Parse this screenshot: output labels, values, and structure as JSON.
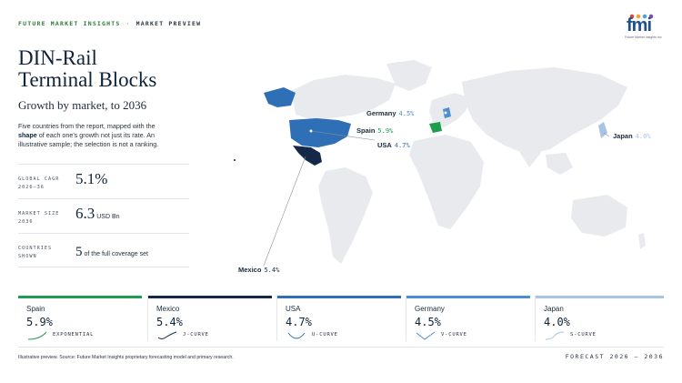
{
  "header": {
    "brand": "FUTURE MARKET INSIGHTS",
    "separator": "·",
    "section": "MARKET PREVIEW",
    "logo_text": "fmi",
    "logo_sub": "Future Market Insights Inc."
  },
  "title": {
    "line1": "DIN-Rail",
    "line2": "Terminal Blocks",
    "subtitle": "Growth by market, to 2036"
  },
  "description": {
    "part1": "Five countries from the report, mapped with the ",
    "bold": "shape",
    "part2": " of each one's growth not just its rate. An illustrative sample; the selection is not a ranking."
  },
  "stats": [
    {
      "label1": "GLOBAL CAGR",
      "label2": "2026–36",
      "value": "5.1%",
      "unit": ""
    },
    {
      "label1": "MARKET SIZE",
      "label2": "2036",
      "value": "6.3",
      "unit": "USD Bn"
    },
    {
      "label1": "COUNTRIES",
      "label2": "SHOWN",
      "value": "5",
      "unit": "of the full coverage set"
    }
  ],
  "map_callouts": [
    {
      "country": "Germany",
      "pct": "4.5%"
    },
    {
      "country": "Spain",
      "pct": "5.9%"
    },
    {
      "country": "USA",
      "pct": "4.7%"
    },
    {
      "country": "Japan",
      "pct": "4.0%"
    },
    {
      "country": "Mexico",
      "pct": "5.4%"
    }
  ],
  "colors": {
    "spain": "#1f9d4f",
    "mexico": "#14294a",
    "usa": "#2f6fb5",
    "germany": "#4a8fd0",
    "japan": "#a9c4e3",
    "land": "#e8eaed"
  },
  "cards": [
    {
      "name": "Spain",
      "value": "5.9%",
      "shape": "EXPONENTIAL",
      "color": "#1f9d4f"
    },
    {
      "name": "Mexico",
      "value": "5.4%",
      "shape": "J-CURVE",
      "color": "#14294a"
    },
    {
      "name": "USA",
      "value": "4.7%",
      "shape": "U-CURVE",
      "color": "#2f6fb5"
    },
    {
      "name": "Germany",
      "value": "4.5%",
      "shape": "V-CURVE",
      "color": "#4a8fd0"
    },
    {
      "name": "Japan",
      "value": "4.0%",
      "shape": "S-CURVE",
      "color": "#a9c4e3"
    }
  ],
  "footer": {
    "note": "Illustrative preview. Source: Future Market Insights proprietary forecasting model and primary research.",
    "forecast": "FORECAST 2026 – 2036"
  }
}
